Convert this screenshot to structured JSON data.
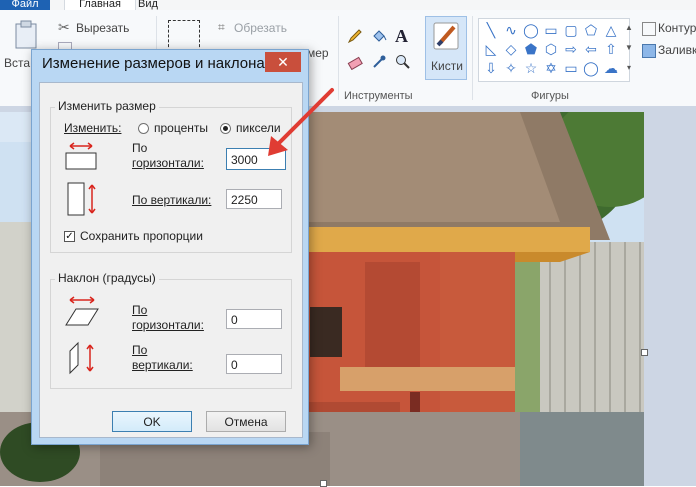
{
  "menu": {
    "file": "Файл",
    "home": "Главная",
    "view": "Вид"
  },
  "ribbon": {
    "paste": "Вста",
    "cut": "Вырезать",
    "crop": "Обрезать",
    "resize_partial": "мер",
    "tools_label": "Инструменты",
    "brushes": "Кисти",
    "shapes_label": "Фигуры",
    "outline": "Контур",
    "fill": "Заливк"
  },
  "dialog": {
    "title": "Изменение размеров и наклона",
    "close": "✕",
    "resize_group": "Изменить размер",
    "by_label": "Изменить:",
    "percent": "проценты",
    "pixels": "пиксели",
    "horizontal_1": "По",
    "horizontal_2": "горизонтали:",
    "vertical": "По вертикали:",
    "width_value": "3000",
    "height_value": "2250",
    "keep_ratio": "Сохранить пропорции",
    "skew_group": "Наклон (градусы)",
    "skew_h_value": "0",
    "skew_v_1": "По",
    "skew_v_2": "вертикали:",
    "skew_v_value": "0",
    "ok": "OK",
    "cancel": "Отмена"
  },
  "colors": {
    "accent": "#1e62b3",
    "arrow": "#e03c33",
    "dialog_frame": "#b9d7f3"
  }
}
